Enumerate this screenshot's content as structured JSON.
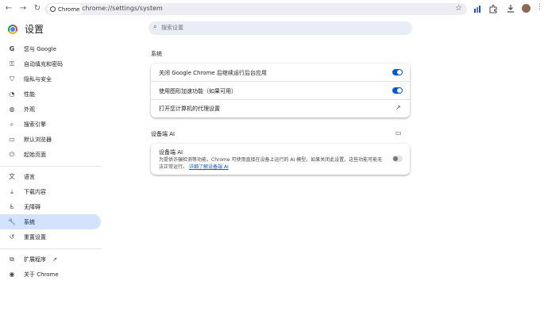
{
  "toolbar": {
    "site_chip": "Chrome",
    "url": "chrome://settings/system"
  },
  "header": {
    "title": "设置",
    "search_placeholder": "搜索设置"
  },
  "sidebar": {
    "items": [
      {
        "label": "您与 Google",
        "icon": "google-g-icon"
      },
      {
        "label": "自动填充和密码",
        "icon": "key-icon"
      },
      {
        "label": "隐私与安全",
        "icon": "shield-icon"
      },
      {
        "label": "性能",
        "icon": "speedometer-icon"
      },
      {
        "label": "外观",
        "icon": "palette-icon"
      },
      {
        "label": "搜索引擎",
        "icon": "search-icon"
      },
      {
        "label": "默认浏览器",
        "icon": "browser-window-icon"
      },
      {
        "label": "起始页面",
        "icon": "power-icon"
      },
      {
        "label": "语言",
        "icon": "translate-icon"
      },
      {
        "label": "下载内容",
        "icon": "download-icon"
      },
      {
        "label": "无障碍",
        "icon": "accessibility-icon"
      },
      {
        "label": "系统",
        "icon": "wrench-icon",
        "active": true
      },
      {
        "label": "重置设置",
        "icon": "reset-icon"
      },
      {
        "label": "扩展程序",
        "icon": "puzzle-icon"
      },
      {
        "label": "关于 Chrome",
        "icon": "chrome-logo-icon"
      }
    ]
  },
  "system": {
    "title": "系统",
    "rows": [
      {
        "label": "关闭 Google Chrome 后继续运行后台应用",
        "control": "toggle",
        "enabled": true
      },
      {
        "label": "使用图形加速功能（如果可用）",
        "control": "toggle",
        "enabled": true
      },
      {
        "label": "打开您计算机的代理设置",
        "control": "open-external"
      }
    ]
  },
  "ondevice_ai": {
    "section_title": "设备端 AI",
    "card_title": "设备端 AI",
    "description": "为提供诈骗检测等功能，Chrome 可使用直接在设备上运行的 AI 模型。如果关闭此设置，这些功能可能无法正常运行。",
    "link": "详细了解设备端 AI",
    "enabled": false
  },
  "colors": {
    "accent": "#0b57d0",
    "active_nav_bg": "#d3e3fd",
    "search_bg": "#e9eef6"
  }
}
